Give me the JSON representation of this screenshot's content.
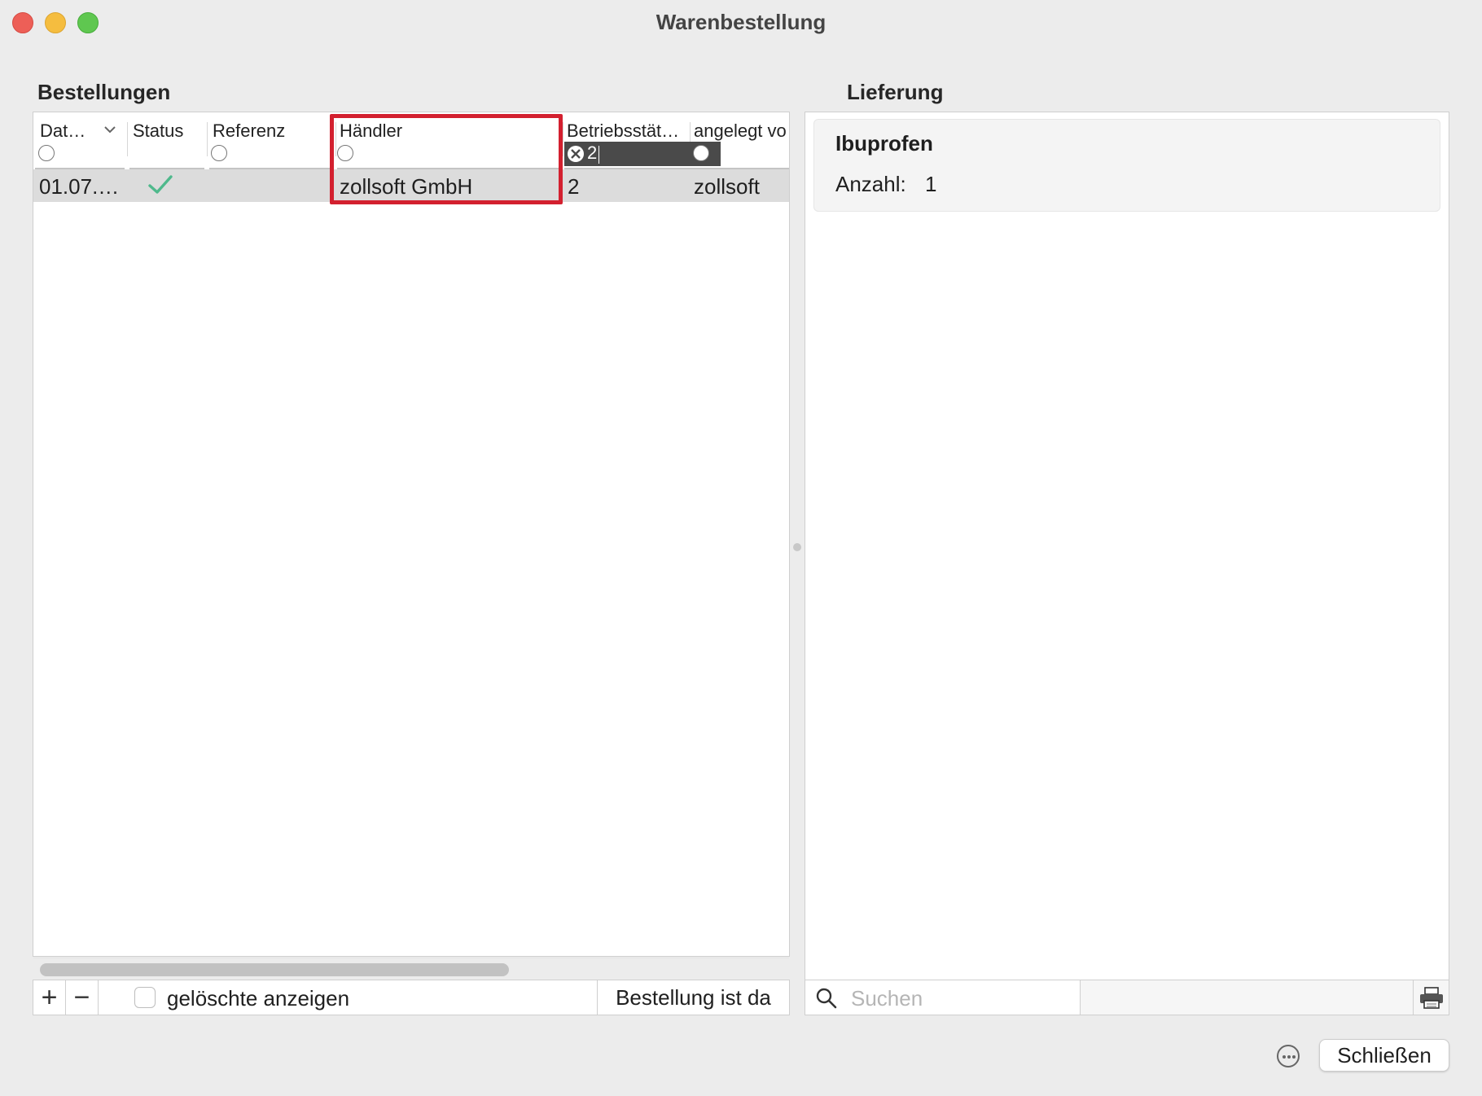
{
  "window": {
    "title": "Warenbestellung"
  },
  "orders": {
    "section_label": "Bestellungen",
    "columns": [
      "Dat…",
      "Status",
      "Referenz",
      "Händler",
      "Betriebsstät…",
      "angelegt vo"
    ],
    "filter_value": "2",
    "rows": [
      {
        "datum": "01.07.…",
        "status": "done",
        "referenz": "",
        "haendler": "zollsoft GmbH",
        "betriebsstaette": "2",
        "angelegt_von": "zollsoft"
      }
    ]
  },
  "footer_left": {
    "add_label": "+",
    "remove_label": "−",
    "show_deleted_label": "gelöschte anzeigen",
    "delivered_label": "Bestellung ist da"
  },
  "delivery": {
    "section_label": "Lieferung",
    "item_name": "Ibuprofen",
    "count_label": "Anzahl:",
    "count_value": "1"
  },
  "search": {
    "placeholder": "Suchen"
  },
  "actions": {
    "close_label": "Schließen"
  },
  "colors": {
    "highlight": "#d3202f",
    "check": "#4fb98c"
  }
}
